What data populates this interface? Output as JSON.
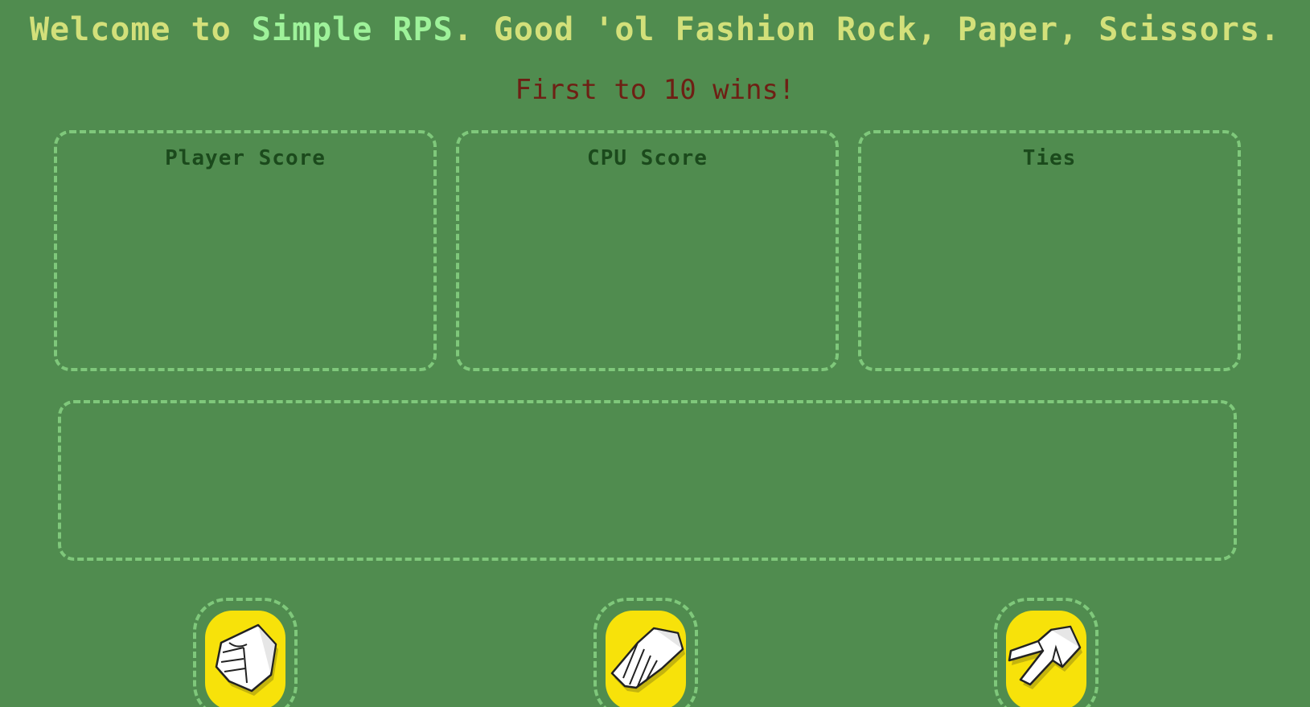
{
  "header": {
    "welcome_prefix": "Welcome to ",
    "brand": "Simple RPS",
    "welcome_suffix": ". Good 'ol Fashion Rock, Paper, Scissors.",
    "rules": "First to 10 wins!"
  },
  "scoreboard": {
    "player_label": "Player Score",
    "cpu_label": "CPU Score",
    "ties_label": "Ties"
  },
  "choices": [
    {
      "name": "rock",
      "icon": "fist-icon"
    },
    {
      "name": "paper",
      "icon": "open-hand-icon"
    },
    {
      "name": "scissors",
      "icon": "peace-hand-icon"
    }
  ],
  "colors": {
    "background": "#508c4f",
    "headline": "#d3e07a",
    "brand": "#9ef29a",
    "rules": "#6e1f14",
    "panel_border": "#7fc87b",
    "label": "#1b4a1c",
    "button": "#f7e20a"
  }
}
